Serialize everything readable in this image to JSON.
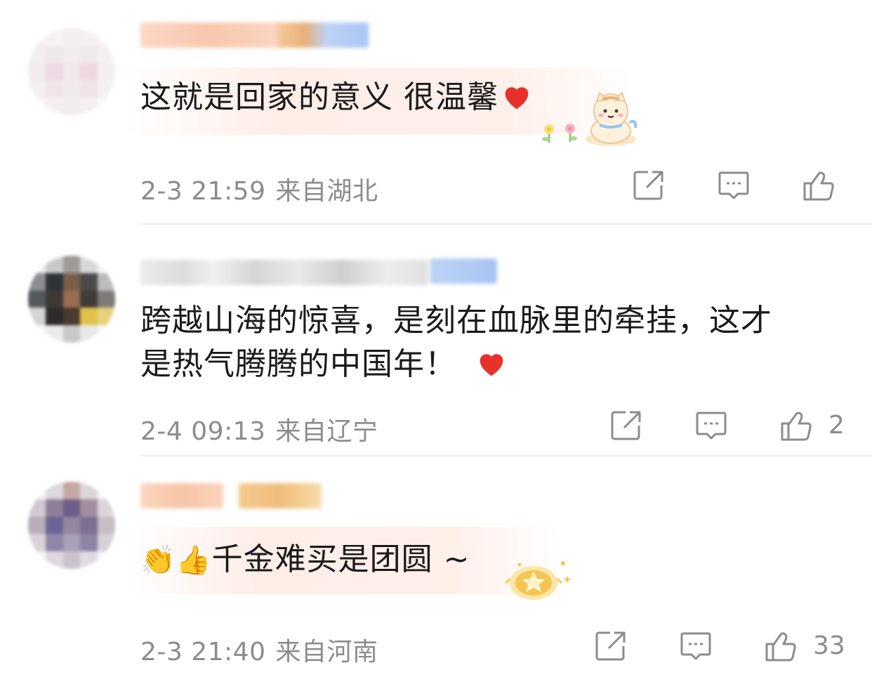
{
  "comments": [
    {
      "text": "这就是回家的意义 很温馨",
      "timestamp": "2-3 21:59",
      "location": "来自湖北",
      "likes": ""
    },
    {
      "text_line1": "跨越山海的惊喜，是刻在血脉里的牵挂，这才",
      "text_line2": "是热气腾腾的中国年！",
      "timestamp": "2-4 09:13",
      "location": "来自辽宁",
      "likes": "2"
    },
    {
      "text": "千金难买是团圆 ~",
      "emoji": "👏👍",
      "timestamp": "2-3 21:40",
      "location": "来自河南",
      "likes": "33"
    }
  ],
  "icons": {
    "share": "share-icon",
    "comment": "comment-icon",
    "like": "thumbs-up-icon",
    "heart": "heart-icon"
  },
  "colors": {
    "text": "#1a1a1a",
    "meta": "#8c8c8c",
    "heart": "#e8312b",
    "divider": "#ececec"
  }
}
